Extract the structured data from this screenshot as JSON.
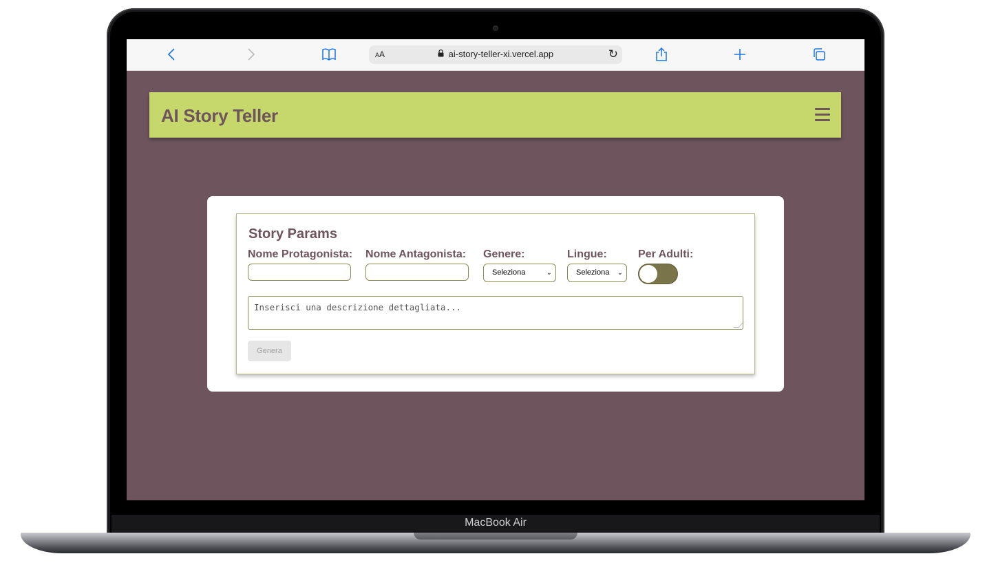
{
  "device": {
    "chin_label": "MacBook Air"
  },
  "browser": {
    "text_size_label": "AA",
    "url": "ai-story-teller-xi.vercel.app",
    "icons": {
      "back": "chevron-left-icon",
      "forward": "chevron-right-icon",
      "bookmarks": "book-icon",
      "lock": "lock-icon",
      "reload": "reload-icon",
      "share": "share-icon",
      "new_tab": "plus-icon",
      "tabs": "tabs-icon"
    }
  },
  "app": {
    "title": "AI Story Teller",
    "menu_icon": "hamburger-menu-icon"
  },
  "form": {
    "title": "Story Params",
    "protagonist_label": "Nome Protagonista:",
    "protagonist_value": "",
    "antagonist_label": "Nome Antagonista:",
    "antagonist_value": "",
    "genre_label": "Genere:",
    "genre_selected": "Seleziona",
    "language_label": "Lingue:",
    "language_selected": "Seleziona",
    "adult_label": "Per Adulti:",
    "adult_enabled": false,
    "description_placeholder": "Inserisci una descrizione dettagliata...",
    "generate_label": "Genera"
  },
  "colors": {
    "page_background": "#6e555d",
    "header_background": "#c6d86c",
    "accent_text": "#6e555d",
    "toggle_track": "#7a7449",
    "browser_accent": "#1a73e8"
  }
}
